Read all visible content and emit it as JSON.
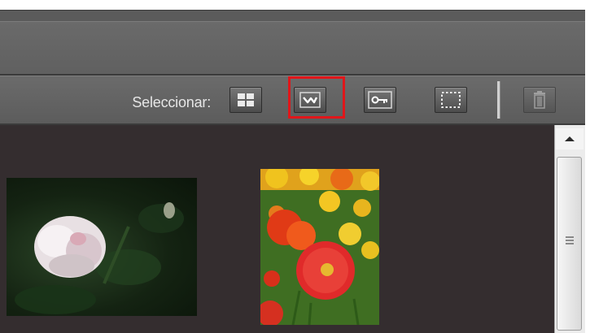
{
  "toolbar": {
    "select_label": "Seleccionar:",
    "buttons": [
      {
        "name": "grid-view",
        "icon": "grid-icon"
      },
      {
        "name": "lasso-select",
        "icon": "zigzag-line-icon",
        "highlighted": true
      },
      {
        "name": "key-select",
        "icon": "key-icon"
      },
      {
        "name": "marquee-select",
        "icon": "dashed-rectangle-icon"
      },
      {
        "name": "delete",
        "icon": "trash-icon",
        "disabled": true
      }
    ],
    "highlight_color": "#e0161a"
  },
  "content": {
    "background": "#342d2f",
    "thumbnails": [
      {
        "subject": "white-rose-photo"
      },
      {
        "subject": "red-and-yellow-poppies-photo"
      }
    ]
  },
  "scrollbar": {
    "up_arrow": "arrow-up-icon",
    "grip": "grip-lines-icon"
  }
}
